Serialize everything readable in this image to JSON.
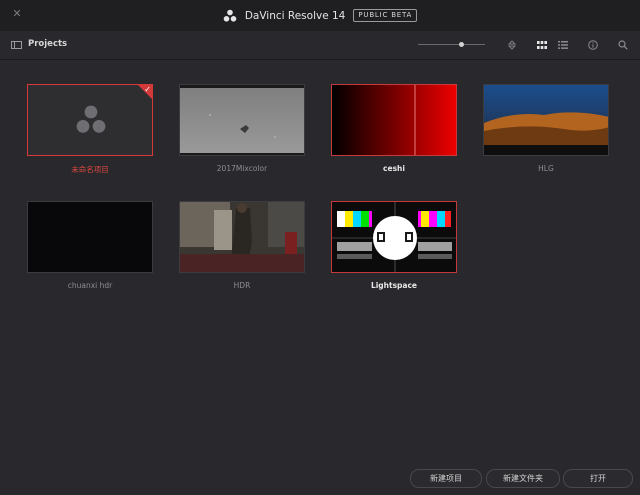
{
  "window": {
    "close_glyph": "✕",
    "app_title": "DaVinci Resolve 14",
    "badge": "PUBLIC BETA"
  },
  "toolbar": {
    "title": "Projects",
    "thumbnail_size_level": 0.65,
    "icons": [
      "panel-toggle-icon",
      "sort-icon",
      "grid-view-icon",
      "list-view-icon",
      "info-icon",
      "search-icon"
    ]
  },
  "projects": [
    {
      "name": "未命名项目",
      "selected": true
    },
    {
      "name": "2017Mixcolor"
    },
    {
      "name": "ceshi"
    },
    {
      "name": "HLG"
    },
    {
      "name": "chuanxi hdr"
    },
    {
      "name": "HDR"
    },
    {
      "name": "Lightspace"
    }
  ],
  "buttons": {
    "new_project": "新建项目",
    "new_folder": "新建文件夹",
    "open": "打开"
  },
  "colors": {
    "accent_red": "#d23a3a",
    "background": "#29292d"
  }
}
